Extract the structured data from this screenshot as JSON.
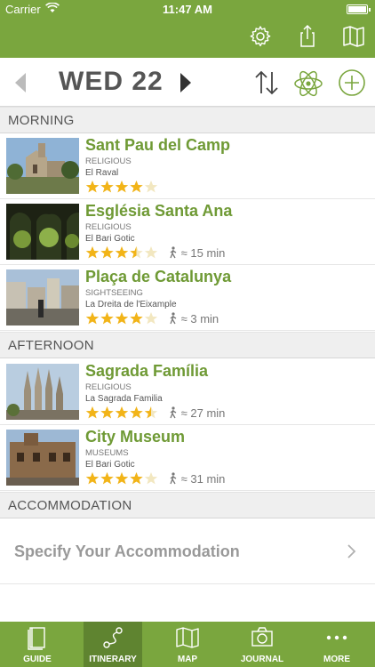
{
  "status": {
    "carrier": "Carrier",
    "time": "11:47 AM"
  },
  "colors": {
    "brand": "#7aa63e",
    "brand_dark": "#5f8430",
    "title": "#6f9a35",
    "star": "#f2b418"
  },
  "day": {
    "label": "WED 22"
  },
  "sections": {
    "morning": "MORNING",
    "afternoon": "AFTERNOON",
    "accommodation": "ACCOMMODATION"
  },
  "items": [
    {
      "title": "Sant Pau del Camp",
      "category": "RELIGIOUS",
      "area": "El Raval",
      "rating": 4,
      "walk": ""
    },
    {
      "title": "Església Santa Ana",
      "category": "RELIGIOUS",
      "area": "El Bari Gotic",
      "rating": 3.5,
      "walk": "≈ 15 min"
    },
    {
      "title": "Plaça de Catalunya",
      "category": "SIGHTSEEING",
      "area": "La Dreita de l'Eixample",
      "rating": 4,
      "walk": "≈ 3 min"
    },
    {
      "title": "Sagrada Família",
      "category": "RELIGIOUS",
      "area": "La Sagrada Familia",
      "rating": 4.5,
      "walk": "≈ 27 min"
    },
    {
      "title": "City Museum",
      "category": "MUSEUMS",
      "area": "El Bari Gotic",
      "rating": 4,
      "walk": "≈ 31 min"
    }
  ],
  "accommodation": {
    "label": "Specify Your Accommodation"
  },
  "tabs": [
    {
      "label": "GUIDE",
      "icon": "book-icon"
    },
    {
      "label": "ITINERARY",
      "icon": "route-icon",
      "active": true
    },
    {
      "label": "MAP",
      "icon": "map-icon"
    },
    {
      "label": "JOURNAL",
      "icon": "camera-icon"
    },
    {
      "label": "MORE",
      "icon": "more-icon"
    }
  ]
}
